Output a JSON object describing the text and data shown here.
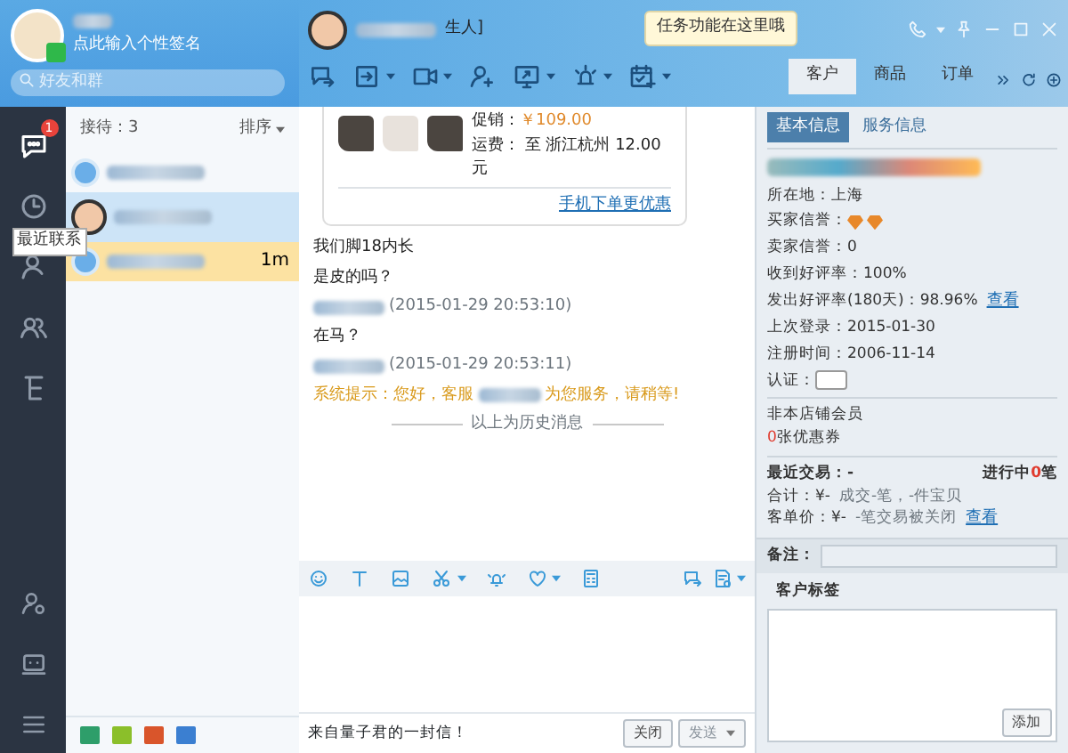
{
  "profile": {
    "signature": "点此输入个性签名",
    "online": true,
    "search": {
      "placeholder": "好友和群"
    }
  },
  "nav": {
    "items": [
      {
        "badge": "1",
        "selected": true
      },
      {
        "selected": false,
        "tooltip": "最近联系"
      },
      {
        "selected": false
      },
      {
        "selected": false
      },
      {
        "selected": false
      }
    ]
  },
  "contacts": {
    "count_label": "接待：3",
    "sort": "排序",
    "items": [
      {
        "kind": "logo",
        "selected": false,
        "hovered": false
      },
      {
        "kind": "face",
        "selected": false,
        "hovered": true
      },
      {
        "kind": "logo",
        "selected": true,
        "hovered": false,
        "time": "1m"
      }
    ],
    "tools": [
      {
        "color": "#2e9e6a"
      },
      {
        "color": "#8bbf2a"
      },
      {
        "color": "#d9552b"
      },
      {
        "color": "#3b7fd1"
      }
    ]
  },
  "chat": {
    "contact_suffix": "生人]",
    "tooltip": "任务功能在这里哦",
    "toolbar": [
      {
        "caret": false
      },
      {
        "caret": true
      },
      {
        "caret": true
      },
      {
        "caret": false
      },
      {
        "caret": true
      },
      {
        "caret": true
      },
      {
        "caret": true
      }
    ],
    "product": {
      "price_label": "促销：",
      "price": "￥109.00",
      "shipping": "运费： 至 浙江杭州 12.00 元",
      "link": "手机下单更优惠"
    },
    "messages": [
      {
        "kind": "text",
        "text": "我们脚18内长"
      },
      {
        "kind": "text",
        "text": "是皮的吗？"
      },
      {
        "kind": "meta",
        "text": "(2015-01-29 20:53:10)"
      },
      {
        "kind": "text",
        "text": "在马？"
      },
      {
        "kind": "meta",
        "text": "(2015-01-29 20:53:11)"
      },
      {
        "kind": "system",
        "text": "系统提示：您好，客服",
        "text_after": "为您服务，请稍等!"
      },
      {
        "kind": "divider",
        "text": "以上为历史消息"
      }
    ],
    "input_toolbar": [
      {
        "caret": false
      },
      {
        "caret": false
      },
      {
        "caret": false
      },
      {
        "caret": true
      },
      {
        "caret": false
      },
      {
        "caret": true
      },
      {
        "caret": false
      }
    ],
    "input_toolbar_right": [
      {
        "caret": false
      },
      {
        "caret": true
      }
    ],
    "footer_text": "来自量子君的一封信！",
    "close_button": "关闭",
    "send_button": "发送",
    "send_disabled": true
  },
  "side_tabs": [
    {
      "label": "客户",
      "selected": true
    },
    {
      "label": "商品",
      "selected": false
    },
    {
      "label": "订单",
      "selected": false
    }
  ],
  "customer": {
    "tabs": [
      {
        "label": "基本信息",
        "selected": true
      },
      {
        "label": "服务信息",
        "selected": false
      }
    ],
    "rows": [
      {
        "kind": "text",
        "label": "所在地：",
        "value": "上海"
      },
      {
        "kind": "icons",
        "label": "买家信誉：",
        "icons": [
          {
            "kind": "diamond"
          },
          {
            "kind": "diamond"
          }
        ]
      },
      {
        "kind": "text",
        "label": "卖家信誉：",
        "value": "0"
      },
      {
        "kind": "text",
        "label": "收到好评率：",
        "value": "100%"
      },
      {
        "kind": "link",
        "label": "发出好评率(180天)：",
        "value": "98.96%",
        "link": "查看"
      },
      {
        "kind": "text",
        "label": "上次登录：",
        "value": "2015-01-30"
      },
      {
        "kind": "text",
        "label": "注册时间：",
        "value": "2006-11-14"
      },
      {
        "kind": "badge",
        "label": "认证："
      }
    ],
    "membership": "非本店铺会员",
    "coupon_count": "0",
    "coupon_label": "张优惠券",
    "recent_label": "最近交易：-",
    "ongoing_prefix": "进行中",
    "ongoing_count": "0",
    "ongoing_suffix": "笔",
    "total_label": "合计：",
    "total_value": "¥-",
    "total_detail": "成交-笔，-件宝贝",
    "avg_label": "客单价：",
    "avg_value": "¥-",
    "avg_detail": "-笔交易被关闭",
    "avg_link": "查看",
    "note_label": "备注：",
    "tags_title": "客户标签",
    "tags_add": "添加"
  }
}
